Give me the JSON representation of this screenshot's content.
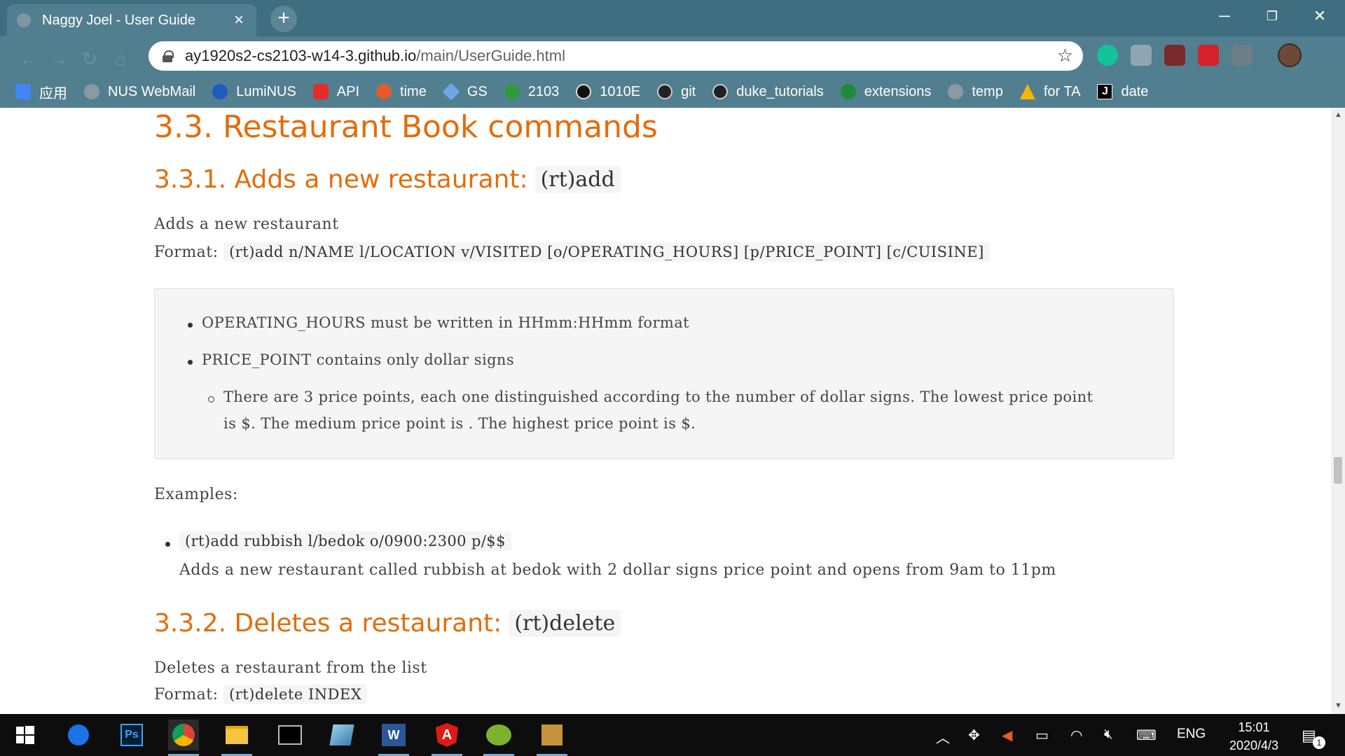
{
  "browser": {
    "tab_title": "Naggy Joel - User Guide",
    "url_host": "ay1920s2-cs2103-w14-3.github.io",
    "url_path": "/main/UserGuide.html"
  },
  "bookmarks": [
    {
      "label": "应用",
      "color": "#4285f4"
    },
    {
      "label": "NUS WebMail",
      "color": "#8a9aa1"
    },
    {
      "label": "LumiNUS",
      "color": "#1e5bbf"
    },
    {
      "label": "API",
      "color": "#e52a2a"
    },
    {
      "label": "time",
      "color": "#e55b2a"
    },
    {
      "label": "GS",
      "color": "#6da7e8"
    },
    {
      "label": "2103",
      "color": "#2f9a3c"
    },
    {
      "label": "1010E",
      "color": "#111111"
    },
    {
      "label": "git",
      "color": "#222222"
    },
    {
      "label": "duke_tutorials",
      "color": "#222222"
    },
    {
      "label": "extensions",
      "color": "#1f8a3a"
    },
    {
      "label": "temp",
      "color": "#8a9aa1"
    },
    {
      "label": "for TA",
      "color": "#f4b400"
    },
    {
      "label": "date",
      "color": "#000000"
    }
  ],
  "doc": {
    "section_title": "3.3. Restaurant Book commands",
    "add": {
      "heading": "3.3.1. Adds a new restaurant:",
      "heading_code": "(rt)add",
      "description": "Adds a new restaurant",
      "format_label": "Format:",
      "format_code": "(rt)add n/NAME l/LOCATION v/VISITED [o/OPERATING_HOURS] [p/PRICE_POINT] [c/CUISINE]",
      "notes": {
        "item1": "OPERATING_HOURS must be written in HHmm:HHmm format",
        "item2": "PRICE_POINT contains only dollar signs",
        "sub1_line1": "There are 3 price points, each one distinguished according to the number of dollar signs. The lowest price point",
        "sub1_line2": "is $. The medium price point is . The highest price point is $."
      },
      "examples_label": "Examples:",
      "example_code": "(rt)add rubbish l/bedok o/0900:2300 p/$$",
      "example_desc": "Adds a new restaurant called rubbish at bedok with 2 dollar signs price point and opens from 9am to 11pm"
    },
    "delete": {
      "heading": "3.3.2. Deletes a restaurant:",
      "heading_code": "(rt)delete",
      "description": "Deletes a restaurant from the list",
      "format_label": "Format:",
      "format_code": "(rt)delete INDEX"
    }
  },
  "taskbar": {
    "language": "ENG",
    "time": "15:01",
    "date": "2020/4/3",
    "notification_count": "1"
  }
}
